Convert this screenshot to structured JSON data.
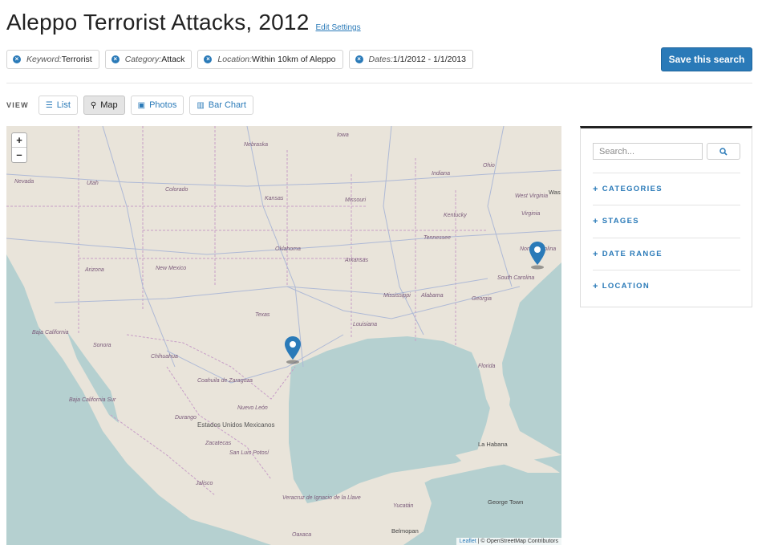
{
  "header": {
    "title": "Aleppo Terrorist Attacks, 2012",
    "edit_settings": "Edit Settings",
    "save_search": "Save this search"
  },
  "filters": [
    {
      "key": "Keyword:",
      "value": "Terrorist"
    },
    {
      "key": "Category:",
      "value": "Attack"
    },
    {
      "key": "Location:",
      "value": "Within 10km of Aleppo"
    },
    {
      "key": "Dates:",
      "value": "1/1/2012 - 1/1/2013"
    }
  ],
  "view": {
    "label": "VIEW",
    "options": [
      {
        "label": "List",
        "icon": "list-icon",
        "active": false
      },
      {
        "label": "Map",
        "icon": "map-marker-icon",
        "active": true
      },
      {
        "label": "Photos",
        "icon": "photo-icon",
        "active": false
      },
      {
        "label": "Bar Chart",
        "icon": "bar-chart-icon",
        "active": false
      }
    ]
  },
  "map": {
    "zoom_in": "+",
    "zoom_out": "–",
    "attribution_leaflet": "Leaflet",
    "attribution_rest": " | © OpenStreetMap Contributors",
    "attribution_osm": "OpenStreetMap",
    "region_labels": [
      "Nebraska",
      "Iowa",
      "Indiana",
      "Ohio",
      "Nevada",
      "Utah",
      "Colorado",
      "Kansas",
      "Missouri",
      "Kentucky",
      "West Virginia",
      "Virginia",
      "Tennessee",
      "Oklahoma",
      "Arkansas",
      "North Carolina",
      "South Carolina",
      "Arizona",
      "New Mexico",
      "Mississippi",
      "Alabama",
      "Georgia",
      "Texas",
      "Louisiana",
      "Florida",
      "Baja California",
      "Sonora",
      "Chihuahua",
      "Coahuila de Zaragoza",
      "Baja California Sur",
      "Durango",
      "Nuevo León",
      "Estados Unidos Mexicanos",
      "Zacatecas",
      "San Luis Potosí",
      "Jalisco",
      "Veracruz de Ignacio de la Llave",
      "Oaxaca",
      "Yucatán"
    ],
    "city_labels": [
      "La Habana",
      "George Town",
      "Belmopan",
      "Was"
    ],
    "colors": {
      "land": "#e9e4da",
      "water": "#b5d0d0",
      "road": "#aeb9d6",
      "border": "#c79ec7",
      "marker": "#2a7ab8"
    }
  },
  "sidebar": {
    "search_placeholder": "Search...",
    "search_icon": "search-icon",
    "facets": [
      "CATEGORIES",
      "STAGES",
      "DATE RANGE",
      "LOCATION"
    ]
  },
  "colors": {
    "accent": "#2a7ab8"
  }
}
